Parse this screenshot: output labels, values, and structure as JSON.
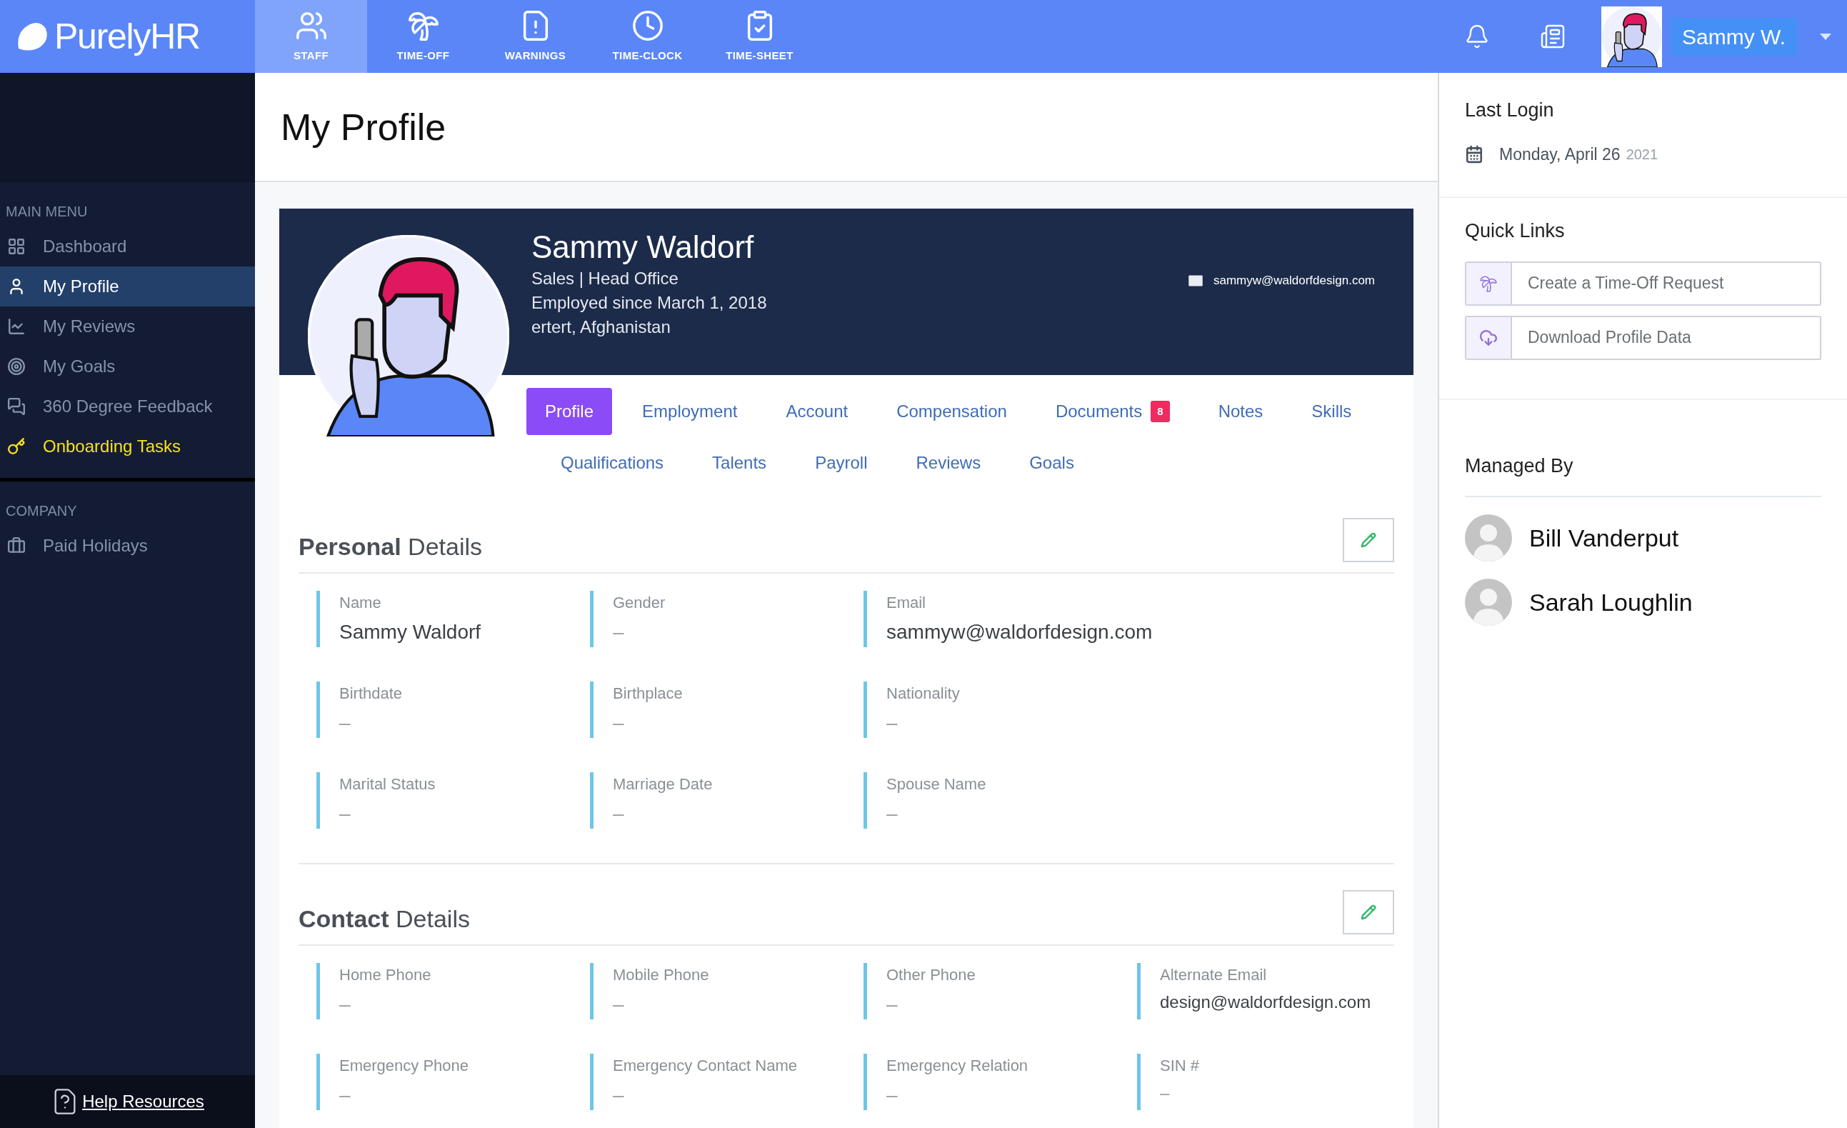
{
  "brand": {
    "name": "PurelyHR"
  },
  "top_nav": [
    {
      "label": "STAFF",
      "selected": true
    },
    {
      "label": "TIME-OFF",
      "selected": false
    },
    {
      "label": "WARNINGS",
      "selected": false
    },
    {
      "label": "TIME-CLOCK",
      "selected": false
    },
    {
      "label": "TIME-SHEET",
      "selected": false
    }
  ],
  "user_menu": {
    "name": "Sammy W."
  },
  "sidebar": {
    "sections": [
      {
        "title": "MAIN MENU",
        "items": [
          {
            "label": "Dashboard",
            "selected": false,
            "highlighted": false
          },
          {
            "label": "My Profile",
            "selected": true,
            "highlighted": false
          },
          {
            "label": "My Reviews",
            "selected": false,
            "highlighted": false
          },
          {
            "label": "My Goals",
            "selected": false,
            "highlighted": false
          },
          {
            "label": "360 Degree Feedback",
            "selected": false,
            "highlighted": false
          },
          {
            "label": "Onboarding Tasks",
            "selected": false,
            "highlighted": true
          }
        ]
      },
      {
        "title": "COMPANY",
        "items": [
          {
            "label": "Paid Holidays",
            "selected": false,
            "highlighted": false
          }
        ]
      }
    ],
    "help_link": "Help Resources"
  },
  "page_title": "My Profile",
  "profile": {
    "name": "Sammy Waldorf",
    "department": "Sales | Head Office",
    "employed": "Employed since March 1, 2018",
    "location": "ertert, Afghanistan",
    "email": "sammyw@waldorfdesign.com"
  },
  "tab_rows": [
    [
      {
        "label": "Profile",
        "selected": true
      },
      {
        "label": "Employment",
        "selected": false
      },
      {
        "label": "Account",
        "selected": false
      },
      {
        "label": "Compensation",
        "selected": false
      },
      {
        "label": "Documents",
        "selected": false,
        "badge": "8"
      },
      {
        "label": "Notes",
        "selected": false
      },
      {
        "label": "Skills",
        "selected": false
      }
    ],
    [
      {
        "label": "Qualifications",
        "selected": false
      },
      {
        "label": "Talents",
        "selected": false
      },
      {
        "label": "Payroll",
        "selected": false
      },
      {
        "label": "Reviews",
        "selected": false
      },
      {
        "label": "Goals",
        "selected": false
      }
    ]
  ],
  "sections": [
    {
      "title": "**Personal** Details",
      "rows": [
        [
          {
            "label": "Name",
            "value": "Sammy Waldorf"
          },
          {
            "label": "Gender",
            "value": "–"
          },
          {
            "label": "Email",
            "value": "sammyw@waldorfdesign.com"
          }
        ],
        [
          {
            "label": "Birthdate",
            "value": "–"
          },
          {
            "label": "Birthplace",
            "value": "–"
          },
          {
            "label": "Nationality",
            "value": "–"
          }
        ],
        [
          {
            "label": "Marital Status",
            "value": "–"
          },
          {
            "label": "Marriage Date",
            "value": "–"
          },
          {
            "label": "Spouse Name",
            "value": "–"
          }
        ]
      ]
    },
    {
      "title": "**Contact** Details",
      "rows": [
        [
          {
            "label": "Home Phone",
            "value": "–"
          },
          {
            "label": "Mobile Phone",
            "value": "–"
          },
          {
            "label": "Other Phone",
            "value": "–"
          },
          {
            "label": "Alternate Email",
            "value": "design@waldorfdesign.com"
          }
        ],
        [
          {
            "label": "Emergency Phone",
            "value": "–"
          },
          {
            "label": "Emergency Contact Name",
            "value": "–"
          },
          {
            "label": "Emergency Relation",
            "value": "–"
          },
          {
            "label": "SIN #",
            "value": "–"
          }
        ]
      ]
    }
  ],
  "last_login": {
    "title": "Last Login",
    "date": "Monday, April 26",
    "year": "2021"
  },
  "quick_links": {
    "title": "Quick Links",
    "items": [
      "Create a Time-Off Request",
      "Download Profile Data"
    ]
  },
  "managed_by": {
    "title": "Managed By",
    "people": [
      "Bill Vanderput",
      "Sarah Loughlin"
    ]
  }
}
